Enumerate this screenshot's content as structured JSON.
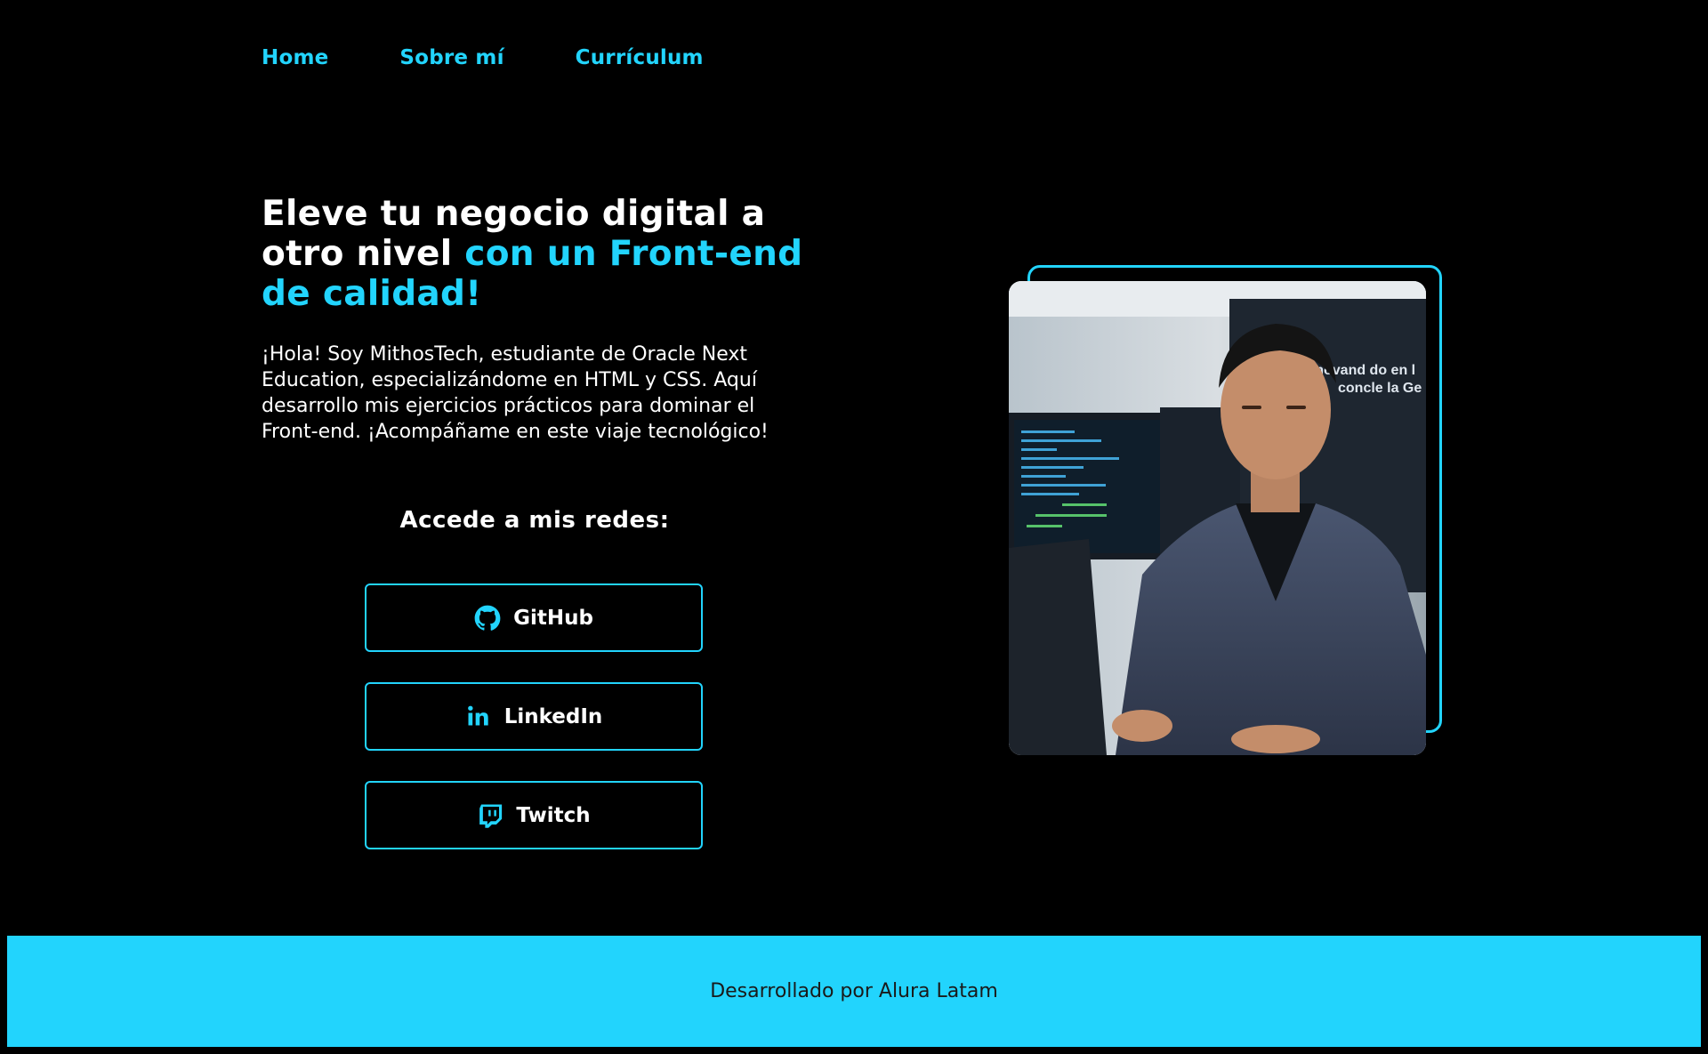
{
  "nav": {
    "items": [
      {
        "label": "Home"
      },
      {
        "label": "Sobre mí"
      },
      {
        "label": "Currículum"
      }
    ]
  },
  "hero": {
    "title_part1": "Eleve tu negocio digital a otro nivel ",
    "title_accent": "con un Front-end de calidad!",
    "description": "¡Hola! Soy MithosTech, estudiante de Oracle Next Education, especializándome en HTML y CSS. Aquí desarrollo mis ejercicios prácticos para dominar el Front-end. ¡Acompáñame en este viaje tecnológico!"
  },
  "social": {
    "heading": "Accede a mis redes:",
    "buttons": [
      {
        "label": "GitHub",
        "icon": "github-icon"
      },
      {
        "label": "LinkedIn",
        "icon": "linkedin-icon"
      },
      {
        "label": "Twitch",
        "icon": "twitch-icon"
      }
    ]
  },
  "footer": {
    "text": "Desarrollado por Alura Latam"
  },
  "colors": {
    "accent": "#22d4fd",
    "background": "#000000",
    "text": "#ffffff",
    "footer_text": "#1a1a1a"
  }
}
